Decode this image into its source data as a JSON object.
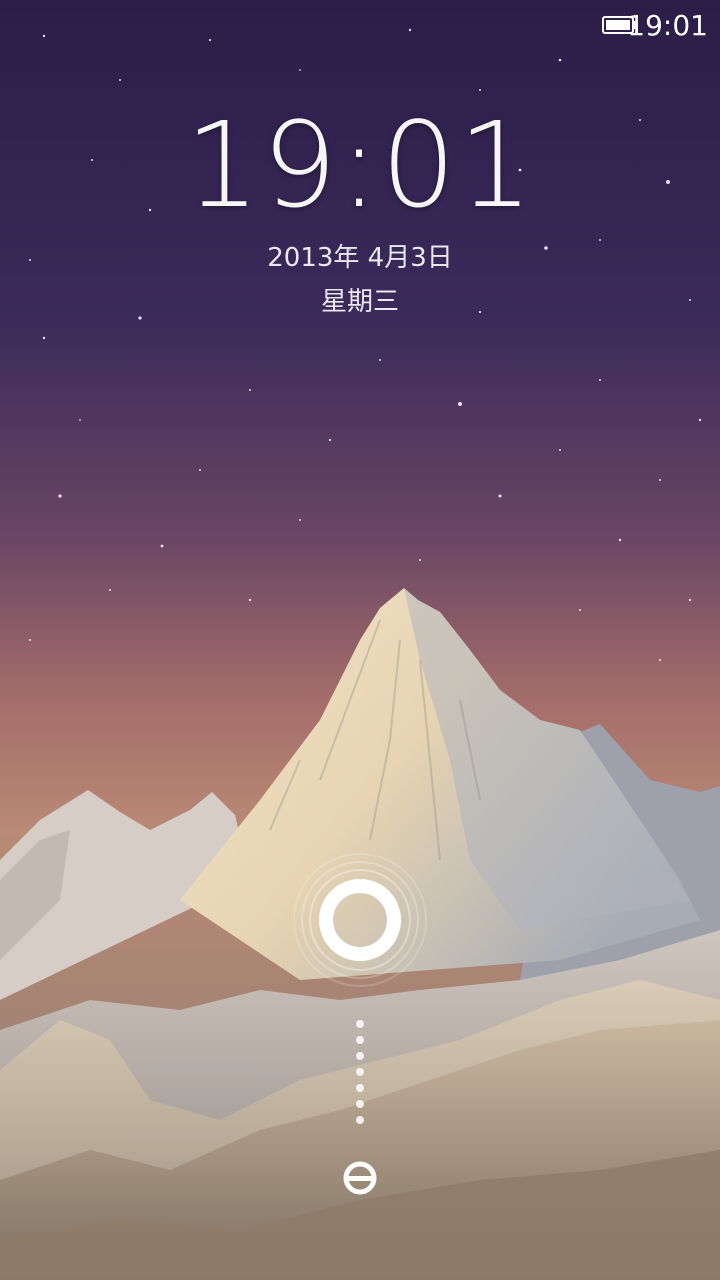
{
  "status_bar": {
    "time": "19:01",
    "battery_icon": "battery-icon"
  },
  "lockscreen": {
    "clock": "19:01",
    "date": "2013年 4月3日",
    "weekday": "星期三"
  },
  "unlock": {
    "handle_icon": "unlock-ring-icon",
    "track_icon": "dotted-track-icon",
    "target_icon": "miui-unlock-icon"
  },
  "colors": {
    "sky_top": "#2a1e48",
    "sky_mid": "#4a3565",
    "sky_horizon": "#b77c6c",
    "snow": "#e8dcc8"
  }
}
